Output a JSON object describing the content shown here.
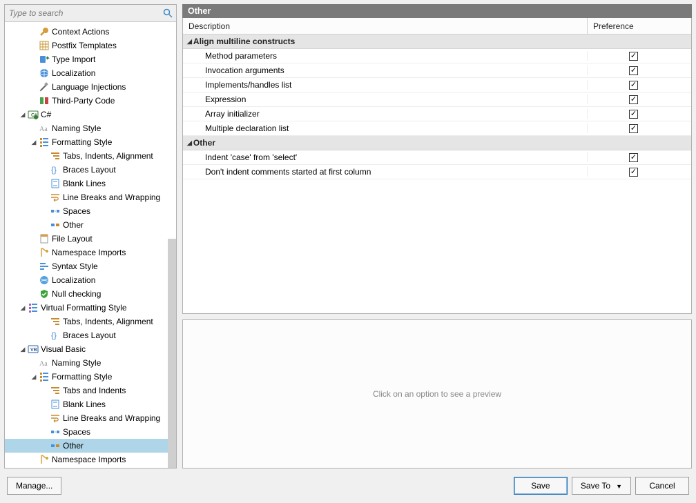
{
  "search": {
    "placeholder": "Type to search"
  },
  "tree": [
    {
      "depth": 1,
      "toggle": "",
      "icon": "wrench",
      "label": "Context Actions"
    },
    {
      "depth": 1,
      "toggle": "",
      "icon": "grid",
      "label": "Postfix Templates"
    },
    {
      "depth": 1,
      "toggle": "",
      "icon": "typeimp",
      "label": "Type Import"
    },
    {
      "depth": 1,
      "toggle": "",
      "icon": "globe",
      "label": "Localization"
    },
    {
      "depth": 1,
      "toggle": "",
      "icon": "syringe",
      "label": "Language Injections"
    },
    {
      "depth": 1,
      "toggle": "",
      "icon": "thirdp",
      "label": "Third-Party Code"
    },
    {
      "depth": 0,
      "toggle": "open",
      "icon": "lang-cs",
      "label": "C#"
    },
    {
      "depth": 1,
      "toggle": "",
      "icon": "naming",
      "label": "Naming Style"
    },
    {
      "depth": 1,
      "toggle": "open",
      "icon": "format",
      "label": "Formatting Style"
    },
    {
      "depth": 2,
      "toggle": "",
      "icon": "tabs",
      "label": "Tabs, Indents, Alignment"
    },
    {
      "depth": 2,
      "toggle": "",
      "icon": "braces",
      "label": "Braces Layout"
    },
    {
      "depth": 2,
      "toggle": "",
      "icon": "blank",
      "label": "Blank Lines"
    },
    {
      "depth": 2,
      "toggle": "",
      "icon": "wrap",
      "label": "Line Breaks and Wrapping"
    },
    {
      "depth": 2,
      "toggle": "",
      "icon": "spaces",
      "label": "Spaces"
    },
    {
      "depth": 2,
      "toggle": "",
      "icon": "other",
      "label": "Other"
    },
    {
      "depth": 1,
      "toggle": "",
      "icon": "layout",
      "label": "File Layout"
    },
    {
      "depth": 1,
      "toggle": "",
      "icon": "ns",
      "label": "Namespace Imports"
    },
    {
      "depth": 1,
      "toggle": "",
      "icon": "syntax",
      "label": "Syntax Style"
    },
    {
      "depth": 1,
      "toggle": "",
      "icon": "globe2",
      "label": "Localization"
    },
    {
      "depth": 1,
      "toggle": "",
      "icon": "shield",
      "label": "Null checking"
    },
    {
      "depth": 0,
      "toggle": "open",
      "icon": "vformat",
      "label": "Virtual Formatting Style"
    },
    {
      "depth": 2,
      "toggle": "",
      "icon": "tabs",
      "label": "Tabs, Indents, Alignment"
    },
    {
      "depth": 2,
      "toggle": "",
      "icon": "braces",
      "label": "Braces Layout"
    },
    {
      "depth": 0,
      "toggle": "open",
      "icon": "lang-vb",
      "label": "Visual Basic"
    },
    {
      "depth": 1,
      "toggle": "",
      "icon": "naming",
      "label": "Naming Style"
    },
    {
      "depth": 1,
      "toggle": "open",
      "icon": "format",
      "label": "Formatting Style"
    },
    {
      "depth": 2,
      "toggle": "",
      "icon": "tabs",
      "label": "Tabs and Indents"
    },
    {
      "depth": 2,
      "toggle": "",
      "icon": "blank",
      "label": "Blank Lines"
    },
    {
      "depth": 2,
      "toggle": "",
      "icon": "wrap",
      "label": "Line Breaks and Wrapping"
    },
    {
      "depth": 2,
      "toggle": "",
      "icon": "spaces",
      "label": "Spaces"
    },
    {
      "depth": 2,
      "toggle": "",
      "icon": "other",
      "label": "Other",
      "selected": true
    },
    {
      "depth": 1,
      "toggle": "",
      "icon": "ns",
      "label": "Namespace Imports"
    }
  ],
  "panel": {
    "title": "Other",
    "columns": {
      "desc": "Description",
      "pref": "Preference"
    },
    "groups": [
      {
        "name": "Align multiline constructs",
        "rows": [
          {
            "desc": "Method parameters",
            "checked": true
          },
          {
            "desc": "Invocation arguments",
            "checked": true
          },
          {
            "desc": "Implements/handles list",
            "checked": true
          },
          {
            "desc": "Expression",
            "checked": true
          },
          {
            "desc": "Array initializer",
            "checked": true
          },
          {
            "desc": "Multiple declaration list",
            "checked": true
          }
        ]
      },
      {
        "name": "Other",
        "rows": [
          {
            "desc": "Indent 'case' from 'select'",
            "checked": true
          },
          {
            "desc": "Don't indent comments started at first column",
            "checked": true
          }
        ]
      }
    ],
    "preview_hint": "Click on an option to see a preview"
  },
  "buttons": {
    "manage": "Manage...",
    "save": "Save",
    "save_to": "Save To",
    "cancel": "Cancel"
  }
}
